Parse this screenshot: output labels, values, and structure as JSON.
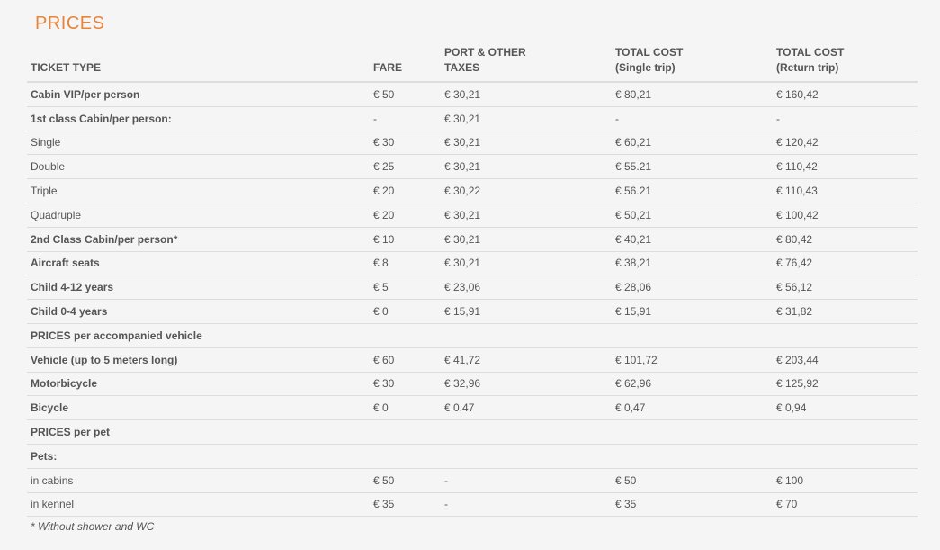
{
  "title": "PRICES",
  "columns": [
    [
      "TICKET TYPE"
    ],
    [
      "FARE"
    ],
    [
      "PORT & OTHER",
      "TAXES"
    ],
    [
      "TOTAL COST",
      "(Single trip)"
    ],
    [
      "TOTAL COST",
      "(Return trip)"
    ]
  ],
  "rows": [
    {
      "label": "Cabin VIP/per person",
      "bold": true,
      "fare": "€ 50",
      "taxes": "€ 30,21",
      "single": "€ 80,21",
      "return": "€ 160,42"
    },
    {
      "label": "1st class Cabin/per person:",
      "bold": true,
      "fare": "-",
      "taxes": "€ 30,21",
      "single": "-",
      "return": "-"
    },
    {
      "label": "Single",
      "bold": false,
      "fare": "€ 30",
      "taxes": "€ 30,21",
      "single": "€ 60,21",
      "return": "€ 120,42"
    },
    {
      "label": "Double",
      "bold": false,
      "fare": "€ 25",
      "taxes": "€ 30,21",
      "single": "€ 55.21",
      "return": "€ 110,42"
    },
    {
      "label": "Triple",
      "bold": false,
      "fare": "€ 20",
      "taxes": "€ 30,22",
      "single": "€ 56.21",
      "return": "€ 110,43"
    },
    {
      "label": "Quadruple",
      "bold": false,
      "fare": "€ 20",
      "taxes": "€ 30,21",
      "single": "€ 50,21",
      "return": "€ 100,42"
    },
    {
      "label": "2nd Class Cabin/per person*",
      "bold": true,
      "fare": "€ 10",
      "taxes": "€ 30,21",
      "single": "€ 40,21",
      "return": "€ 80,42"
    },
    {
      "label": "Aircraft seats",
      "bold": true,
      "fare": "€ 8",
      "taxes": "€ 30,21",
      "single": "€ 38,21",
      "return": "€ 76,42"
    },
    {
      "label": "Child 4-12 years",
      "bold": true,
      "fare": "€ 5",
      "taxes": "€ 23,06",
      "single": "€ 28,06",
      "return": "€ 56,12"
    },
    {
      "label": "Child 0-4 years",
      "bold": true,
      "fare": "€ 0",
      "taxes": "€ 15,91",
      "single": "€ 15,91",
      "return": "€ 31,82"
    },
    {
      "label": "PRICES per accompanied vehicle",
      "bold": true,
      "fare": "",
      "taxes": "",
      "single": "",
      "return": ""
    },
    {
      "label": "Vehicle (up to 5 meters long)",
      "bold": true,
      "fare": "€ 60",
      "taxes": "€ 41,72",
      "single": "€ 101,72",
      "return": "€ 203,44"
    },
    {
      "label": "Motorbicycle",
      "bold": true,
      "fare": "€ 30",
      "taxes": "€ 32,96",
      "single": "€ 62,96",
      "return": "€ 125,92"
    },
    {
      "label": "Bicycle",
      "bold": true,
      "fare": "€ 0",
      "taxes": "€ 0,47",
      "single": "€ 0,47",
      "return": "€ 0,94"
    },
    {
      "label": "PRICES per pet",
      "bold": true,
      "fare": "",
      "taxes": "",
      "single": "",
      "return": ""
    },
    {
      "label": "Pets:",
      "bold": true,
      "fare": "",
      "taxes": "",
      "single": "",
      "return": ""
    },
    {
      "label": "in cabins",
      "bold": false,
      "fare": "€ 50",
      "taxes": "-",
      "single": "€ 50",
      "return": "€ 100"
    },
    {
      "label": "in kennel",
      "bold": false,
      "fare": "€ 35",
      "taxes": "-",
      "single": "€ 35",
      "return": "€ 70"
    }
  ],
  "footnote": "* Without shower and WC"
}
